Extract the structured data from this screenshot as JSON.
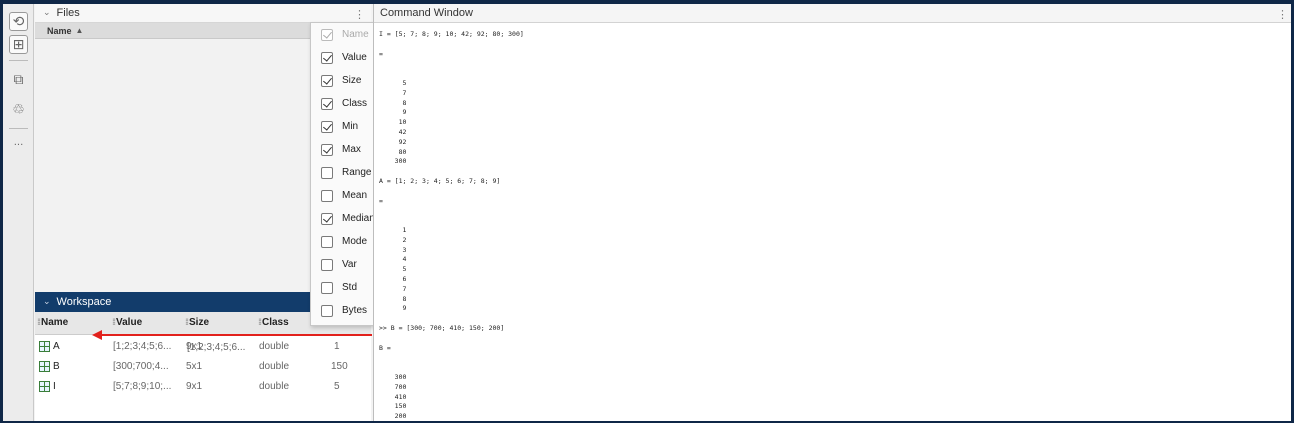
{
  "rail": {
    "icons": [
      "history-icon",
      "workspace-grid-icon",
      "addons-icon",
      "modules-icon",
      "more-icon"
    ]
  },
  "files": {
    "title": "Files",
    "column_name": "Name",
    "sort_indicator": "▲"
  },
  "workspace": {
    "title": "Workspace",
    "columns": [
      "Name",
      "Value",
      "Size",
      "Class"
    ],
    "rows": [
      {
        "name": "A",
        "value": "[1;2;3;4;5;6...",
        "size": "9x1",
        "class": "double",
        "extra": "1"
      },
      {
        "name": "B",
        "value": "[300;700;4...",
        "size": "5x1",
        "class": "double",
        "extra": "150"
      },
      {
        "name": "I",
        "value": "[5;7;8;9;10;...",
        "size": "9x1",
        "class": "double",
        "extra": "5"
      }
    ]
  },
  "column_menu": {
    "items": [
      {
        "label": "Name",
        "checked": true,
        "disabled": true
      },
      {
        "label": "Value",
        "checked": true,
        "disabled": false
      },
      {
        "label": "Size",
        "checked": true,
        "disabled": false
      },
      {
        "label": "Class",
        "checked": true,
        "disabled": false
      },
      {
        "label": "Min",
        "checked": true,
        "disabled": false
      },
      {
        "label": "Max",
        "checked": true,
        "disabled": false
      },
      {
        "label": "Range",
        "checked": false,
        "disabled": false
      },
      {
        "label": "Mean",
        "checked": false,
        "disabled": false
      },
      {
        "label": "Median",
        "checked": true,
        "disabled": false
      },
      {
        "label": "Mode",
        "checked": false,
        "disabled": false
      },
      {
        "label": "Var",
        "checked": false,
        "disabled": false
      },
      {
        "label": "Std",
        "checked": false,
        "disabled": false
      },
      {
        "label": "Bytes",
        "checked": false,
        "disabled": false
      }
    ]
  },
  "command_window": {
    "title": "Command Window",
    "lines": [
      "I = [5; 7; 8; 9; 10; 42; 92; 80; 300]",
      "",
      "=",
      "",
      "",
      "      5",
      "      7",
      "      8",
      "      9",
      "     10",
      "     42",
      "     92",
      "     80",
      "    300",
      "",
      "A = [1; 2; 3; 4; 5; 6; 7; 8; 9]",
      "",
      "=",
      "",
      "",
      "      1",
      "      2",
      "      3",
      "      4",
      "      5",
      "      6",
      "      7",
      "      8",
      "      9",
      "",
      ">> B = [300; 700; 410; 150; 200]",
      "",
      "B =",
      "",
      "",
      "    300",
      "    700",
      "    410",
      "    150",
      "    200"
    ]
  },
  "colors": {
    "frame": "#0f2747",
    "workspace_bar": "#123c6b",
    "arrow": "#e2211c"
  }
}
